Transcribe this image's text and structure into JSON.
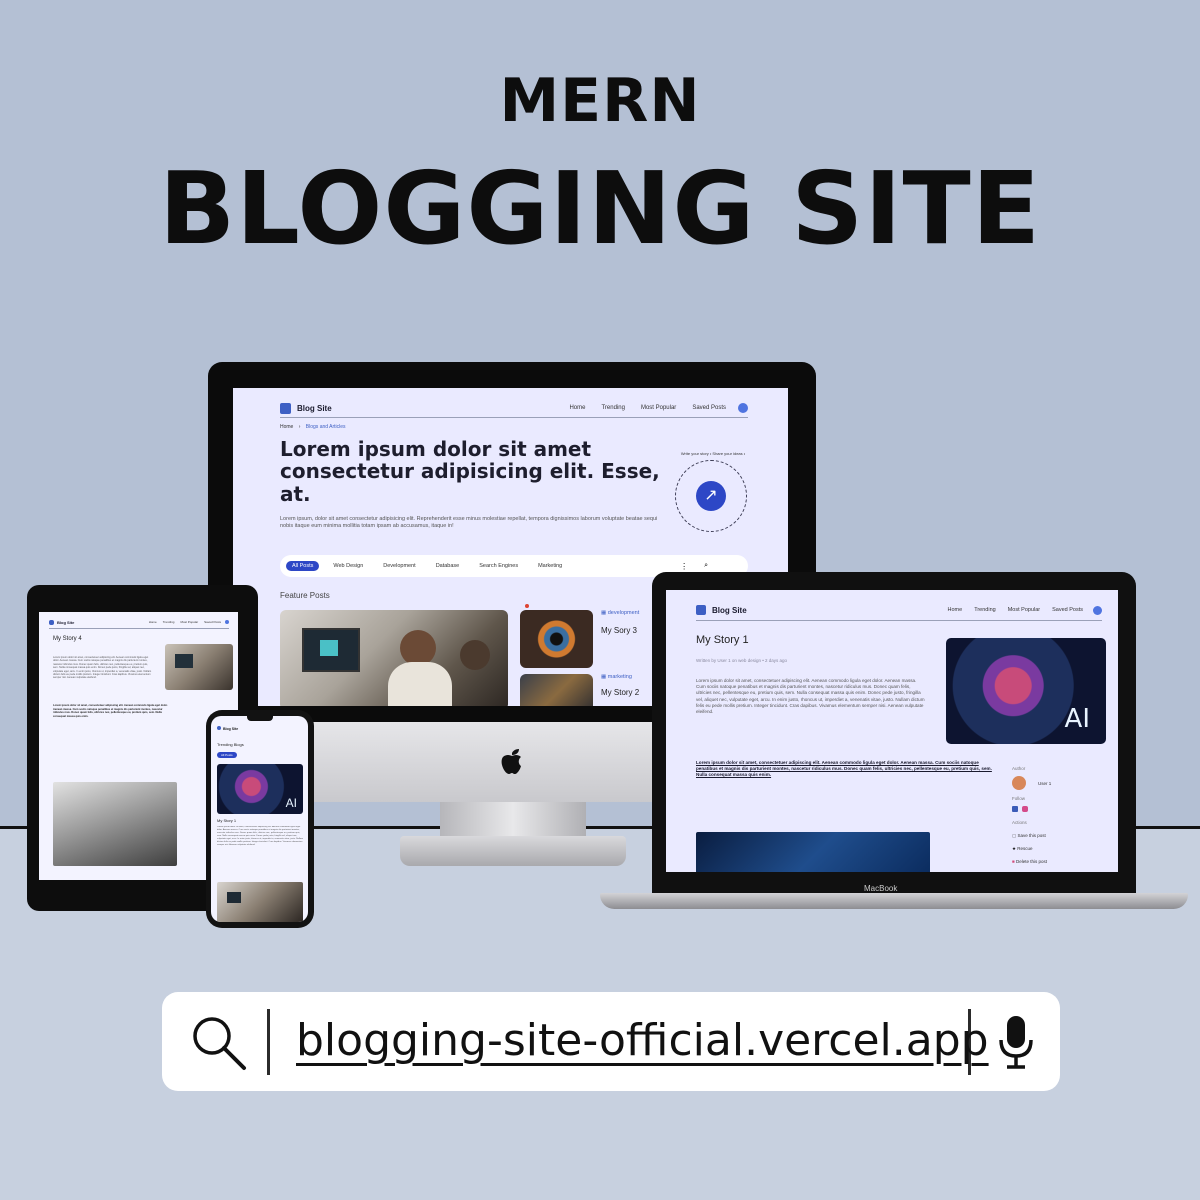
{
  "poster": {
    "title_small": "MERN",
    "title_large": "BLOGGING SITE"
  },
  "site": {
    "brand": "Blog Site",
    "nav": [
      "Home",
      "Trending",
      "Most Popular",
      "Saved Posts"
    ],
    "breadcrumb": [
      "Home",
      "Blogs and Articles"
    ],
    "hero_title": "Lorem ipsum dolor sit amet consectetur adipisicing elit. Esse, at.",
    "hero_text": "Lorem ipsum, dolor sit amet consectetur adipisicing elit. Reprehenderit esse minus molestiae repellat, tempora dignissimos laborum voluptate beatae sequi nobis itaque eum minima mollitia totam ipsam ab accusamus, itaque in!",
    "write_badge": "Write your story • Share your ideas •",
    "categories": [
      "All Posts",
      "Web Design",
      "Development",
      "Database",
      "Search Engines",
      "Marketing"
    ],
    "section_title": "Feature Posts",
    "side_posts": [
      {
        "category": "development",
        "title": "My Sory 3"
      },
      {
        "category": "marketing",
        "title": "My Story 2"
      }
    ]
  },
  "laptop": {
    "post_title": "My Story 1",
    "meta": "Written by  User 1  on  web design  • 2 days ago",
    "body_text": "Lorem ipsum dolor sit amet, consectetuer adipiscing elit. Aenean commodo ligula eget dolor. Aenean massa. Cum sociis natoque penatibus et magnis dis parturient montes, nascetur ridiculus mus. Donec quam felis, ultricies nec, pellentesque eu, pretium quis, sem. Nulla consequat massa quis enim. Donec pede justo, fringilla vel, aliquet nec, vulputate eget, arcu. In enim justo, rhoncus ut, imperdiet a, venenatis vitae, justo. Nullam dictum felis eu pede mollis pretium. Integer tincidunt. Cras dapibus. Vivamus elementum semper nisi. Aenean vulputate eleifend.",
    "bold_text": "Lorem ipsum dolor sit amet, consectetuer adipiscing elit. Aenean commodo ligula eget dolor. Aenean massa. Cum sociis natoque penatibus et magnis dis parturient montes, nascetur ridiculus mus. Donec quam felis, ultricies nec, pellentesque eu, pretium quis, sem. Nulla consequat massa quis enim.",
    "image_label": "AI",
    "author_label": "Author",
    "author_name": "User 1",
    "follow_label": "Follow",
    "actions_label": "Actions",
    "actions": [
      "Save this post",
      "Rescue",
      "Delete this post"
    ],
    "brand_mark": "MacBook"
  },
  "tablet": {
    "post_title": "My Story 4"
  },
  "phone": {
    "heading": "Trending Blogs",
    "button": "All Posts",
    "post_title": "My Story 1"
  },
  "search": {
    "url": "blogging-site-official.vercel.app"
  }
}
